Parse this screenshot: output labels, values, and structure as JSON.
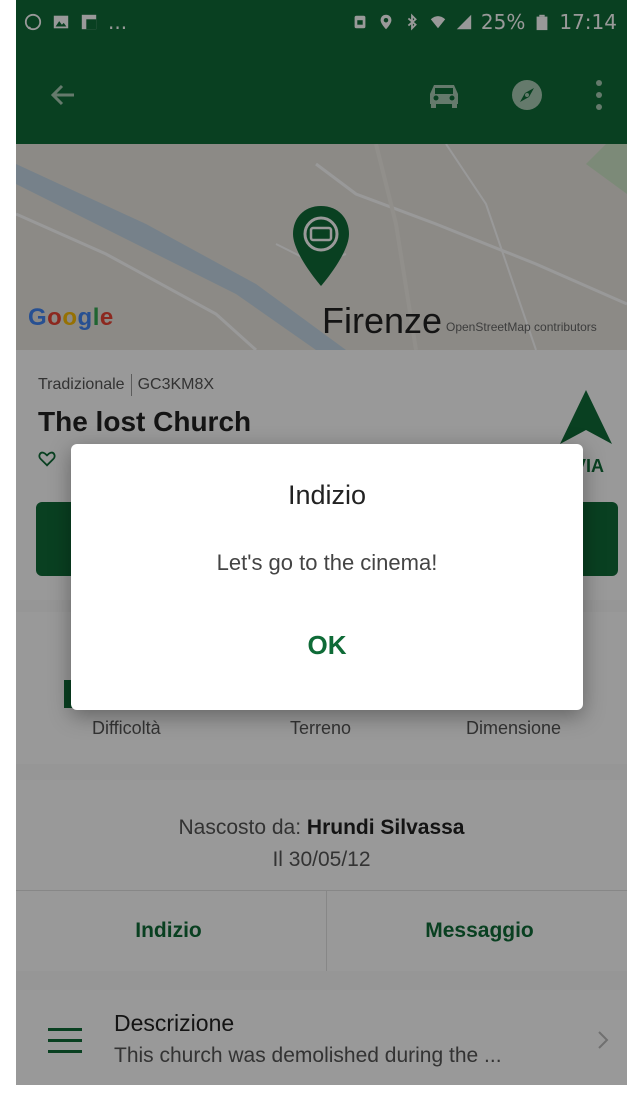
{
  "status_bar": {
    "left_icons": [
      "whatsapp-icon",
      "image-icon",
      "flipboard-icon"
    ],
    "more_indicator": "...",
    "battery": "25%",
    "time": "17:14",
    "right_icons": [
      "sim-icon",
      "location-icon",
      "bluetooth-icon",
      "wifi-icon",
      "signal-icon",
      "battery-icon"
    ]
  },
  "toolbar": {
    "icons": [
      "back-arrow-icon",
      "car-icon",
      "compass-icon",
      "more-vert-icon"
    ]
  },
  "map": {
    "logo": "Google",
    "city_label": "Firenze",
    "attribution": "OpenStreetMap contributors"
  },
  "cache": {
    "type": "Tradizionale",
    "code": "GC3KM8X",
    "title": "The lost Church",
    "nav_label": "VIA"
  },
  "stats": {
    "difficulty_label": "Difficoltà",
    "terrain_label": "Terreno",
    "size_label": "Dimensione"
  },
  "owner": {
    "hidden_by_label": "Nascosto da:",
    "hidden_by_name": "Hrundi Silvassa",
    "date": "Il 30/05/12"
  },
  "actions": {
    "hint_label": "Indizio",
    "message_label": "Messaggio"
  },
  "description": {
    "title": "Descrizione",
    "text": "This church was demolished during the ..."
  },
  "dialog": {
    "title": "Indizio",
    "message": "Let's go to the cinema!",
    "ok_label": "OK"
  },
  "colors": {
    "primary": "#0f6b37",
    "scrim": "rgba(0,0,0,0.40)"
  }
}
